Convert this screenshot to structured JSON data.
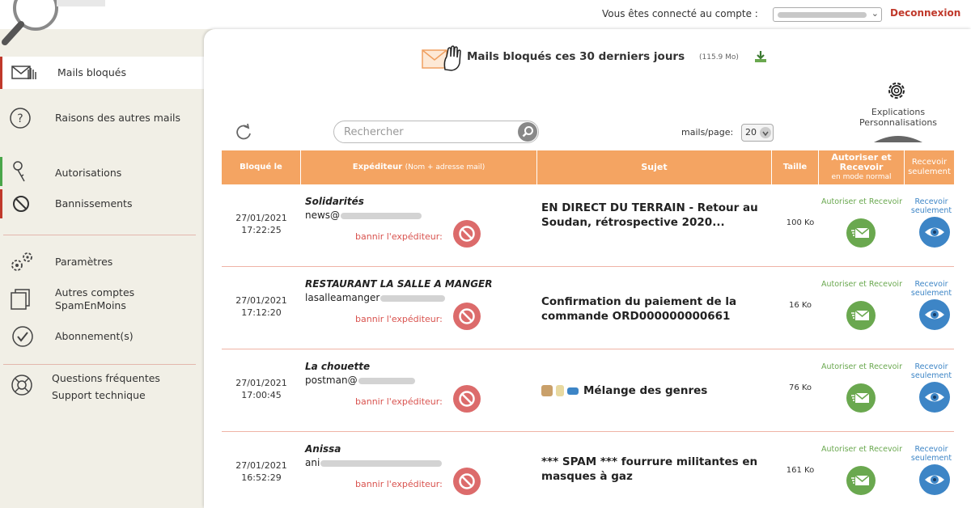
{
  "header": {
    "account_label": "Vous êtes connecté au compte :",
    "logout_label": "Deconnexion"
  },
  "sidebar": {
    "items": [
      {
        "label": "Mails bloqués"
      },
      {
        "label": "Raisons des autres mails"
      },
      {
        "label": "Autorisations"
      },
      {
        "label": "Bannissements"
      },
      {
        "label": "Paramètres"
      },
      {
        "label": "Autres comptes SpamEnMoins"
      },
      {
        "label": "Abonnement(s)"
      },
      {
        "label": "Questions fréquentes"
      },
      {
        "label": "Support technique"
      }
    ]
  },
  "main": {
    "title": "Mails bloqués ces 30 derniers jours",
    "size_total": "(115.9 Mo)",
    "settings_label_1": "Explications",
    "settings_label_2": "Personnalisations",
    "search_placeholder": "Rechercher",
    "perpage_label": "mails/page:",
    "perpage_value": "20"
  },
  "table": {
    "headers": {
      "blocked": "Bloqué le",
      "sender": "Expéditeur",
      "sender_note": "(Nom + adresse mail)",
      "subject": "Sujet",
      "size": "Taille",
      "allow": "Autoriser et Recevoir",
      "allow_note": "en mode normal",
      "recv": "Recevoir seulement"
    },
    "ban_label": "bannir l'expéditeur:",
    "allow_label": "Autoriser et Recevoir",
    "recv_label": "Recevoir seulement",
    "rows": [
      {
        "date": "27/01/2021",
        "time": "17:22:25",
        "name": "Solidarités",
        "email": "news@",
        "subject": "EN DIRECT DU TERRAIN - Retour au Soudan, rétrospective 2020...",
        "size": "100 Ko"
      },
      {
        "date": "27/01/2021",
        "time": "17:12:20",
        "name": "RESTAURANT LA SALLE A MANGER",
        "email": "lasalleamanger",
        "subject": "Confirmation du paiement de la commande ORD000000000661",
        "size": "16 Ko"
      },
      {
        "date": "27/01/2021",
        "time": "17:00:45",
        "name": "La chouette",
        "email": "postman@",
        "subject": "Mélange des genres",
        "size": "76 Ko"
      },
      {
        "date": "27/01/2021",
        "time": "16:52:29",
        "name": "Anissa",
        "email": "ani",
        "subject": "*** SPAM *** fourrure militantes en masques à gaz",
        "size": "161 Ko"
      }
    ]
  },
  "colors": {
    "accent_orange": "#f4a462",
    "ban_red": "#d9534f",
    "allow_green": "#6aa84f",
    "recv_blue": "#3d85c6"
  }
}
